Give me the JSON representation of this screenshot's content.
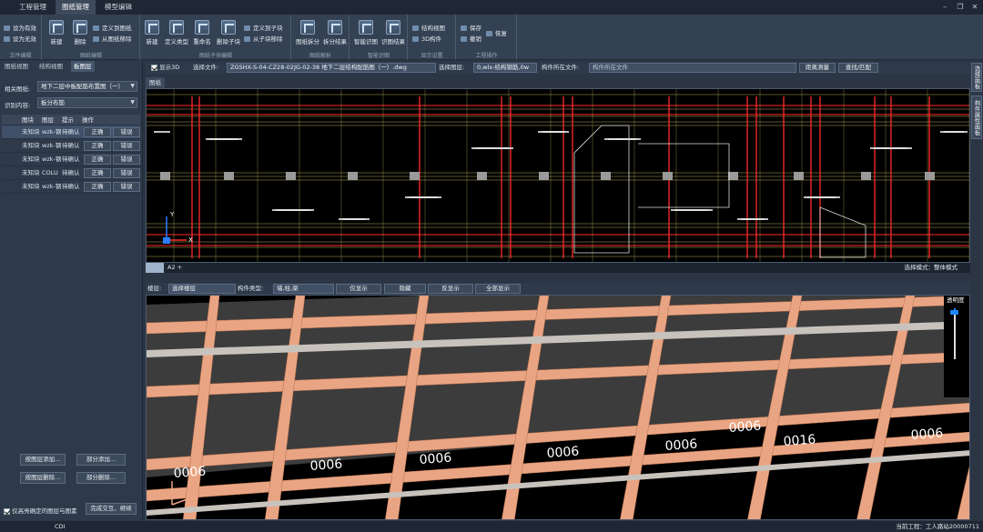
{
  "menu": {
    "tabs": [
      "工程管理",
      "图纸管理",
      "模型编辑"
    ],
    "active_index": 1
  },
  "ribbon": {
    "file_edit": {
      "label": "文件编辑",
      "set_valid": "设为有效",
      "set_invalid": "设为无效"
    },
    "drawing_edit": {
      "label": "图纸编辑",
      "new": "新建",
      "delete": "删除",
      "define_to_drawing": "定义到图纸",
      "remove_from_drawing": "从图纸移除"
    },
    "drawing_sub_edit": {
      "label": "图纸子块编辑",
      "new": "新建",
      "define_type": "定义类型",
      "rename": "重命名",
      "delete_sub": "删除子块",
      "define_to_sub": "定义到子块",
      "remove_from_sub": "从子块移除"
    },
    "drawing_parse": {
      "label": "图纸解析",
      "split": "图纸拆分",
      "split_result": "拆分结果"
    },
    "smart_recognize": {
      "label": "智能识图",
      "smart": "智能识图",
      "result": "识图结果"
    },
    "display_settings": {
      "label": "显示设置",
      "struct_view": "结构视图",
      "comp_3d": "3D构件"
    },
    "project_ops": {
      "label": "工程操作",
      "save": "保存",
      "undo": "撤销",
      "redo": "恢复"
    }
  },
  "left_panel": {
    "tabs": [
      "图纸视图",
      "结构视图",
      "板图层"
    ],
    "active_tab": 2,
    "related_drawing_label": "相关图纸:",
    "related_drawing_value": "地下二层中板配筋布置图（一）",
    "recognize_label": "识别内容:",
    "recognize_value": "板分布筋",
    "table": {
      "headers": [
        "图块",
        "图层",
        "提示",
        "操作"
      ],
      "rows": [
        {
          "block": "未知块",
          "layer": "wzk-钢",
          "hint": "待确认",
          "ok": "正确",
          "err": "错误"
        },
        {
          "block": "未知块",
          "layer": "wzk-钢",
          "hint": "待确认",
          "ok": "正确",
          "err": "错误"
        },
        {
          "block": "未知块",
          "layer": "wzk-钢",
          "hint": "待确认",
          "ok": "正确",
          "err": "错误"
        },
        {
          "block": "未知块",
          "layer": "COLU",
          "hint": "待确认",
          "ok": "正确",
          "err": "错误"
        },
        {
          "block": "未知块",
          "layer": "wzk-钢",
          "hint": "待确认",
          "ok": "正确",
          "err": "错误"
        }
      ]
    },
    "add_by_layer": "按图层添加...",
    "partial_add": "部分添加...",
    "delete_by_layer": "按图层删除...",
    "partial_delete": "部分删除...",
    "only_highlight": "仅高亮确定的图层与图素",
    "finish_button": "完成交互、继续"
  },
  "drawing_toolbar": {
    "show3d_label": "显示3D",
    "select_file_label": "选择文件:",
    "select_file_value": "ZGSHX-S-04-CZ28-02JG-02-38 地下二层结构配筋图（一）.dwg",
    "select_layer_label": "选择图层:",
    "select_layer_value": "0,wlx-结构钢筋,0w",
    "comp_file_label": "构件所在文件:",
    "comp_file_value": "构件所在文件",
    "distance_button": "距离测量",
    "find_button": "查找/匹配"
  },
  "cad": {
    "tab": "图纸",
    "layout_tab": "A2 +",
    "select_mode": "选择模式：整体模式",
    "axis_y": "Y",
    "axis_x": "X"
  },
  "view3d_toolbar": {
    "floor_label": "楼层:",
    "floor_value": "选择楼层",
    "comp_type_label": "构件类型:",
    "comp_type_value": "墙,柱,梁",
    "show_only": "仅显示",
    "hide": "隐藏",
    "reverse": "反显示",
    "show_all": "全部显示"
  },
  "view3d": {
    "transparency_label": "透明度",
    "transparency": 0.93,
    "dims": [
      "0006",
      "0006",
      "0006",
      "0006",
      "0006",
      "0006",
      "0016",
      "0006"
    ]
  },
  "right_strip": {
    "tab1": "选择面板",
    "tab2": "构件属性面板"
  },
  "status": {
    "left": "CDI",
    "right": "当前工程：工人路站20000711"
  },
  "colors": {
    "beam": "#e9a583",
    "slab": "#3c3c3c",
    "cad_red": "#ff2a2a",
    "cad_yellow": "#e8e070"
  }
}
